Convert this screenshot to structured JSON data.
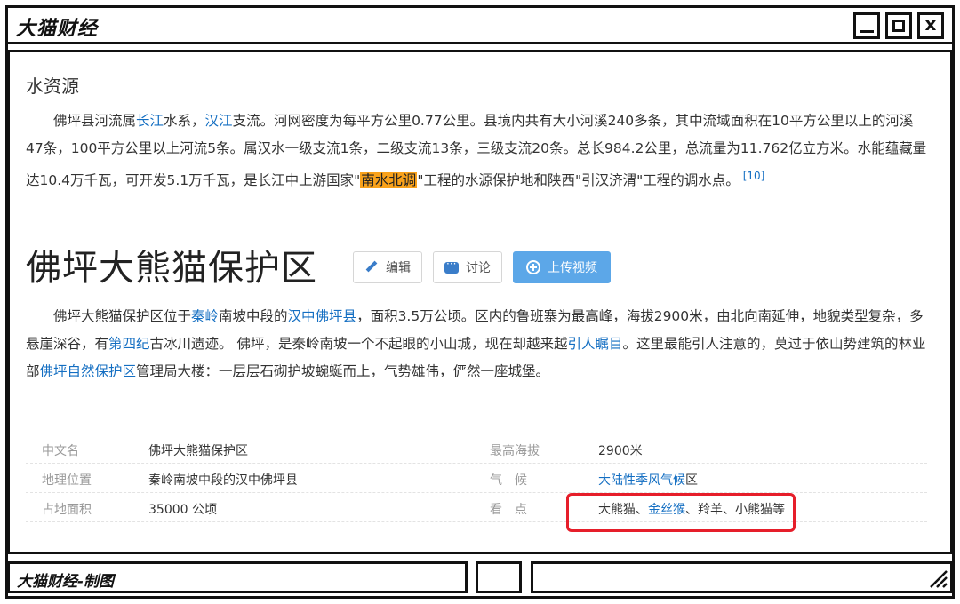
{
  "window": {
    "title": "大猫财经",
    "close_glyph": "x"
  },
  "water_section": {
    "heading": "水资源",
    "text_1": "佛坪县河流属",
    "link_changjiang": "长江",
    "text_2": "水系，",
    "link_hanjiang": "汉江",
    "text_3": "支流。河网密度为每平方公里0.77公里。县境内共有大小河溪240多条，其中流域面积在10平方公里以上的河溪47条，100平方公里以上河流5条。属汉水一级支流1条，二级支流13条，三级支流20条。总长984.2公里，总流量为11.762亿立方米。水能蕴藏量达10.4万千瓦，可开发5.1万千瓦，是长江中上游国家\"",
    "highlight": "南水北调",
    "text_4": "\"工程的水源保护地和陕西\"引汉济渭\"工程的调水点。",
    "ref": "[10]"
  },
  "reserve_section": {
    "title": "佛坪大熊猫保护区",
    "edit_label": "编辑",
    "discuss_label": "讨论",
    "upload_label": "上传视频",
    "text_1": "佛坪大熊猫保护区位于",
    "link_qinling": "秦岭",
    "text_2": "南坡中段的",
    "link_foping": "汉中佛坪县",
    "text_3": "，面积3.5万公顷。区内的鲁班寨为最高峰，海拔2900米，由北向南延伸，地貌类型复杂，多悬崖深谷，有",
    "link_quaternary": "第四纪",
    "text_4": "古冰川遗迹。 佛坪，是秦岭南坡一个不起眼的小山城，现在却越来越",
    "link_attention": "引人瞩目",
    "text_5": "。这里最能引人注意的，莫过于依山势建筑的林业部",
    "link_reserve": "佛坪自然保护区",
    "text_6": "管理局大楼：一层层石砌护坡蜿蜒而上，气势雄伟，俨然一座城堡。"
  },
  "info_table": {
    "rows": [
      {
        "k1": "中文名",
        "v1": "佛坪大熊猫保护区",
        "k2": "最高海拔",
        "v2": "2900米"
      },
      {
        "k1": "地理位置",
        "v1": "秦岭南坡中段的汉中佛坪县",
        "k2": "气　候",
        "v2_link": "大陆性季风气候",
        "v2_tail": "区"
      },
      {
        "k1": "占地面积",
        "v1": "35000 公顷",
        "k2": "看　点",
        "v2_pre": "大熊猫、",
        "v2_link": "金丝猴",
        "v2_tail": "、羚羊、小熊猫等"
      }
    ]
  },
  "footer": {
    "caption": "大猫财经-制图"
  },
  "colors": {
    "link": "#136ec2",
    "highlight": "#f9a21b",
    "upload_button": "#5ca7e8",
    "annotation_box": "#e61e2a"
  },
  "icons": [
    "pencil-icon",
    "chat-icon",
    "plus-circle-icon",
    "minimize-icon",
    "maximize-icon",
    "close-icon",
    "resize-grip-icon"
  ]
}
